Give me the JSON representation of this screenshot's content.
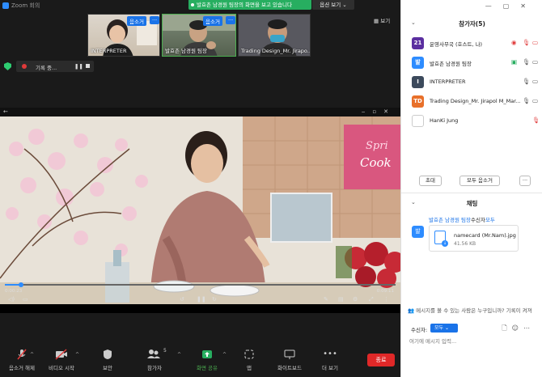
{
  "app": {
    "window_title": "Zoom 회의"
  },
  "share_banner": {
    "text": "발효촌 남경원 팀장의 화면을 보고 있습니다"
  },
  "view_options": {
    "label": "옵션 보기 ⌄"
  },
  "view_button": {
    "label": "보기"
  },
  "thumbnails": [
    {
      "name": "INTERPRETER",
      "mute_label": "음소거",
      "more": "···"
    },
    {
      "name": "발효촌 남경원 팀장",
      "mute_label": "음소거",
      "more": "···"
    },
    {
      "name": "Trading Design_Mr. Jirapo...",
      "mute_label": "",
      "more": ""
    }
  ],
  "recording": {
    "text": "기록 중...",
    "pause_icon": "pause-icon",
    "stop_icon": "stop-icon"
  },
  "video_player": {
    "time_current": "0:00:23",
    "time_total": "0:09:11",
    "progress": 0.042,
    "sign_text_1": "Spri",
    "sign_text_2": "Cook"
  },
  "toolbar": {
    "mute": "음소거 해제",
    "video": "비디오 시작",
    "security": "보안",
    "participants": "참가자",
    "participants_count": "5",
    "share": "화면 공유",
    "apps": "앱",
    "whiteboard": "화이트보드",
    "more": "더 보기",
    "end": "종료"
  },
  "panel": {
    "participants_title": "참가자(5)",
    "participants": [
      {
        "avatar_text": "21",
        "avatar_color": "#5b2fa0",
        "name": "운영사무국 (호스트, 나)"
      },
      {
        "avatar_text": "발",
        "avatar_color": "#2d8cff",
        "name": "발효촌 남경원 팀장"
      },
      {
        "avatar_text": "I",
        "avatar_color": "#3c4a5c",
        "name": "INTERPRETER"
      },
      {
        "avatar_text": "TD",
        "avatar_color": "#e8702a",
        "name": "Trading Design_Mr. Jirapol M_Mar..."
      },
      {
        "avatar_text": "",
        "avatar_color": "#ffffff",
        "name": "HanKi Jung"
      }
    ],
    "invite": "초대",
    "mute_all": "모두 음소거",
    "more_dots": "···",
    "chat_title": "채팅",
    "chat_from": "발효촌 남경원 팀장",
    "chat_to_text": "수신자",
    "chat_to_target": "모두",
    "chat_avatar": "발",
    "file_name": "namecard (Mr.Nam).jpg",
    "file_size": "41.56 KB",
    "notice": "메시지를 볼 수 있는 사람은 누구입니까? 기록이 켜져",
    "recipient_label": "수신자:",
    "recipient_value": "모두 ⌄",
    "input_placeholder": "여기에 메시지 입력..."
  },
  "colors": {
    "accent": "#1a73e8",
    "share_green": "#27ae60",
    "end_red": "#e02828"
  }
}
